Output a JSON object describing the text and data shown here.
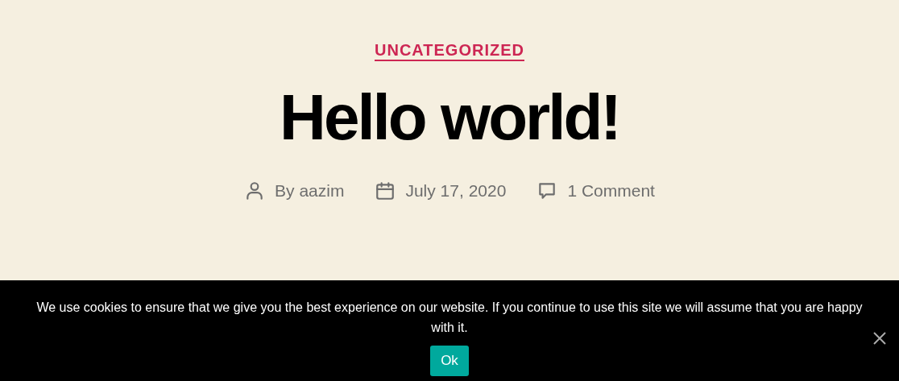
{
  "post": {
    "category": "UNCATEGORIZED",
    "title": "Hello world!",
    "meta": [
      {
        "kind": "author",
        "text": "By aazim"
      },
      {
        "kind": "date",
        "text": "July 17, 2020"
      },
      {
        "kind": "comments",
        "text": "1 Comment"
      }
    ]
  },
  "cookie_notice": {
    "message": "We use cookies to ensure that we give you the best experience on our website. If you continue to use this site we will assume that you are happy with it.",
    "button": "Ok"
  }
}
